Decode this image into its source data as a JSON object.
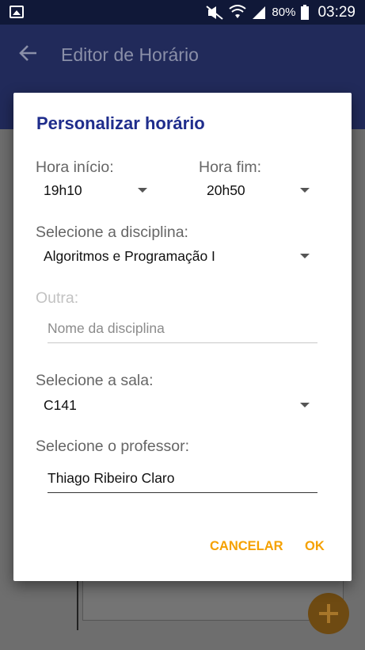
{
  "status_bar": {
    "battery": "80%",
    "time": "03:29",
    "icons": [
      "image-icon",
      "mute-icon",
      "wifi-icon",
      "signal-icon",
      "battery-icon"
    ]
  },
  "app_bar": {
    "title": "Editor de Horário",
    "back_icon": "arrow-left-icon"
  },
  "dialog": {
    "title": "Personalizar horário",
    "start": {
      "label": "Hora início:",
      "value": "19h10"
    },
    "end": {
      "label": "Hora fim:",
      "value": "20h50"
    },
    "subject": {
      "label": "Selecione a disciplina:",
      "value": "Algoritmos e Programação I"
    },
    "other": {
      "label": "Outra:",
      "placeholder": "Nome da disciplina",
      "value": ""
    },
    "room": {
      "label": "Selecione a sala:",
      "value": "C141"
    },
    "teacher": {
      "label": "Selecione o professor:",
      "value": "Thiago Ribeiro Claro"
    },
    "actions": {
      "cancel": "CANCELAR",
      "ok": "OK"
    }
  },
  "colors": {
    "status_bar_bg": "#101838",
    "app_bar_bg": "#212a5a",
    "dialog_title": "#1f2d8c",
    "accent": "#f5a100"
  }
}
